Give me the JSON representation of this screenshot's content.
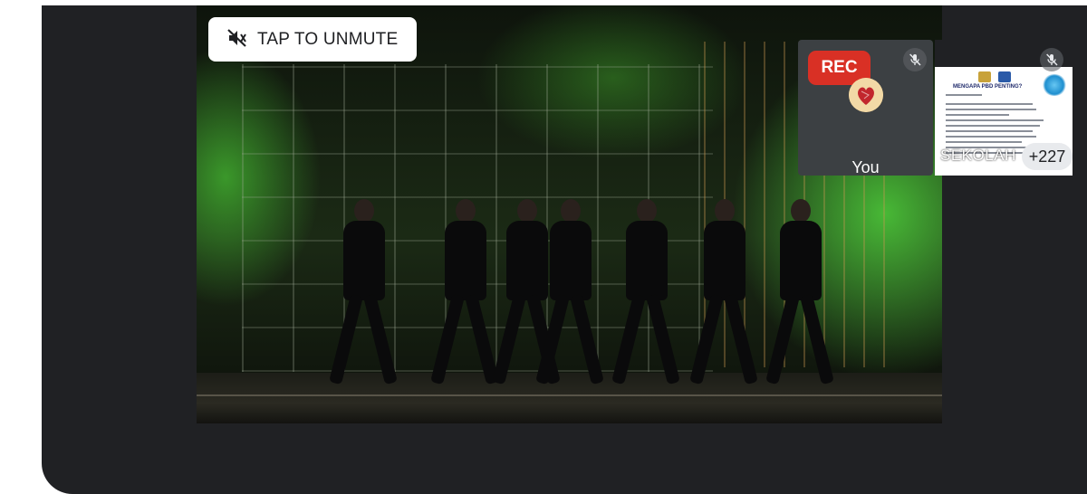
{
  "banner": {
    "unmute_label": "TAP TO UNMUTE"
  },
  "self_tile": {
    "rec_label": "REC",
    "name": "You"
  },
  "presentation_tile": {
    "slide_title": "MENGAPA PBD PENTING?",
    "caption": "SEKOLAH",
    "more_count": "+227"
  },
  "colors": {
    "app_background": "#202124",
    "rec_badge": "#d93025",
    "tile_background": "#3c4043",
    "button_background": "#ffffff"
  },
  "icons": {
    "unmute": "volume-off-icon",
    "self_mic": "mic-off-icon",
    "present_mic": "mic-off-icon"
  }
}
